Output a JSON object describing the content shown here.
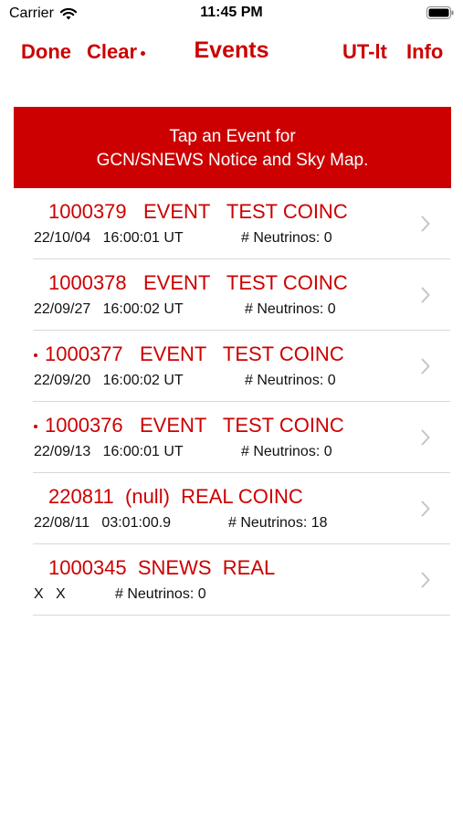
{
  "status_bar": {
    "carrier": "Carrier",
    "time": "11:45 PM"
  },
  "nav": {
    "done_label": "Done",
    "clear_label": "Clear",
    "title": "Events",
    "ut_label": "UT-lt",
    "info_label": "Info"
  },
  "banner": {
    "line1": "Tap an Event for",
    "line2": "GCN/SNEWS Notice and Sky Map."
  },
  "events": [
    {
      "title": "1000379   EVENT   TEST COINC",
      "unread": false,
      "date": "22/10/04   16:00:01 UT",
      "neutrinos": "# Neutrinos: 0"
    },
    {
      "title": "1000378   EVENT   TEST COINC",
      "unread": false,
      "date": "22/09/27   16:00:02 UT",
      "neutrinos": "# Neutrinos: 0"
    },
    {
      "title": "1000377   EVENT   TEST COINC",
      "unread": true,
      "date": "22/09/20   16:00:02 UT",
      "neutrinos": "# Neutrinos: 0"
    },
    {
      "title": "1000376   EVENT   TEST COINC",
      "unread": true,
      "date": "22/09/13   16:00:01 UT",
      "neutrinos": "# Neutrinos: 0"
    },
    {
      "title": "220811  (null)  REAL COINC",
      "unread": false,
      "date": "22/08/11   03:01:00.9",
      "neutrinos": "# Neutrinos: 18"
    },
    {
      "title": "1000345  SNEWS  REAL",
      "unread": false,
      "date": "X   X",
      "neutrinos": "# Neutrinos: 0"
    }
  ],
  "colors": {
    "accent": "#cc0000",
    "separator": "#d8d8d8",
    "chevron": "#c4c4c9"
  },
  "icons": {
    "wifi": "wifi-icon",
    "battery": "battery-icon",
    "chevron": "chevron-right-icon",
    "unread": "unread-dot-icon"
  }
}
